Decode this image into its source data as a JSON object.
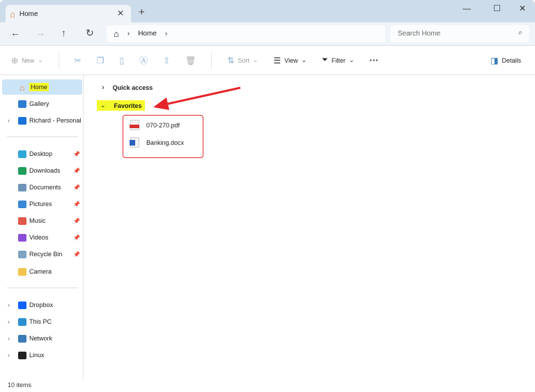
{
  "window": {
    "tab_title": "Home",
    "icon": "home-icon"
  },
  "nav": {
    "breadcrumb": [
      "Home"
    ],
    "search_placeholder": "Search Home"
  },
  "toolbar": {
    "new": "New",
    "sort": "Sort",
    "view": "View",
    "filter": "Filter",
    "details": "Details"
  },
  "sidebar": {
    "items": [
      {
        "label": "Home",
        "icon": "home-icon",
        "selected": true,
        "color": "#e8742a"
      },
      {
        "label": "Gallery",
        "icon": "gallery-icon",
        "color": "#2f7dd1"
      },
      {
        "label": "Richard - Personal",
        "icon": "onedrive-icon",
        "expandable": true,
        "color": "#1a73d9"
      },
      {
        "label": "Desktop",
        "icon": "desktop-icon",
        "pinned": true,
        "color": "#31a7d9"
      },
      {
        "label": "Downloads",
        "icon": "downloads-icon",
        "pinned": true,
        "color": "#1f9e5a"
      },
      {
        "label": "Documents",
        "icon": "documents-icon",
        "pinned": true,
        "color": "#6f94b8"
      },
      {
        "label": "Pictures",
        "icon": "pictures-icon",
        "pinned": true,
        "color": "#3a88d6"
      },
      {
        "label": "Music",
        "icon": "music-icon",
        "pinned": true,
        "color": "#e0584a"
      },
      {
        "label": "Videos",
        "icon": "videos-icon",
        "pinned": true,
        "color": "#8a4fd6"
      },
      {
        "label": "Recycle Bin",
        "icon": "recycle-bin-icon",
        "pinned": true,
        "color": "#7fa3c0"
      },
      {
        "label": "Camera",
        "icon": "folder-icon",
        "color": "#f2c34c"
      },
      {
        "label": "Dropbox",
        "icon": "dropbox-icon",
        "expandable": true,
        "color": "#0f62fe"
      },
      {
        "label": "This PC",
        "icon": "pc-icon",
        "expandable": true,
        "color": "#2a8fd1"
      },
      {
        "label": "Network",
        "icon": "network-icon",
        "expandable": true,
        "color": "#3a7ab8"
      },
      {
        "label": "Linux",
        "icon": "linux-icon",
        "expandable": true,
        "color": "#222222"
      }
    ]
  },
  "main": {
    "quick_access": "Quick access",
    "favorites": "Favorites",
    "files": [
      {
        "name": "070-270.pdf",
        "type": "pdf"
      },
      {
        "name": "Banking.docx",
        "type": "docx"
      }
    ]
  },
  "status": {
    "count": "10 items"
  }
}
